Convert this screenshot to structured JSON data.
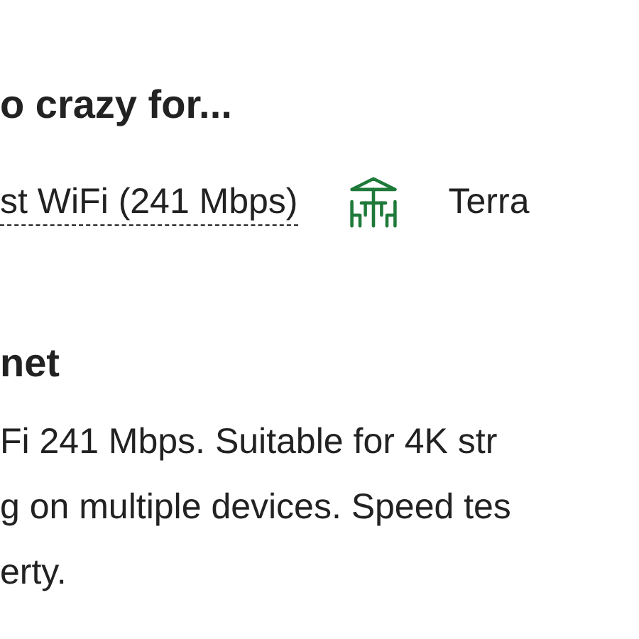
{
  "heading": "o crazy for...",
  "amenities": [
    {
      "kind": "wifi",
      "label": "st WiFi (241 Mbps)",
      "underlined": true
    },
    {
      "kind": "terrace",
      "label": "Terra",
      "underlined": false
    }
  ],
  "section": {
    "title": "net",
    "lines": [
      "Fi 241 Mbps. Suitable for 4K str",
      "g on multiple devices. Speed tes",
      "erty."
    ]
  }
}
